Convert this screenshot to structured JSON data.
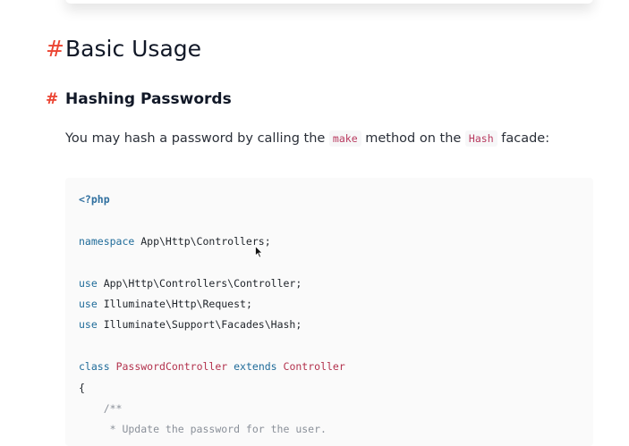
{
  "section_heading": {
    "hash": "#",
    "text": "Basic Usage"
  },
  "subsection_heading": {
    "hash": "#",
    "text": "Hashing Passwords"
  },
  "intro_paragraph": {
    "text_before": "You may hash a password by calling the ",
    "code_1": "make",
    "text_middle": " method on the ",
    "code_2": "Hash",
    "text_after": " facade:"
  },
  "code_block": {
    "language": "php",
    "lines": [
      [
        {
          "t": "<?php",
          "c": "php"
        }
      ],
      [],
      [
        {
          "t": "namespace",
          "c": "kw"
        },
        {
          "t": " App\\Http\\Controllers;",
          "c": ""
        }
      ],
      [],
      [
        {
          "t": "use",
          "c": "kw"
        },
        {
          "t": " App\\Http\\Controllers\\Controller;",
          "c": ""
        }
      ],
      [
        {
          "t": "use",
          "c": "kw"
        },
        {
          "t": " Illuminate\\Http\\Request;",
          "c": ""
        }
      ],
      [
        {
          "t": "use",
          "c": "kw"
        },
        {
          "t": " Illuminate\\Support\\Facades\\Hash;",
          "c": ""
        }
      ],
      [],
      [
        {
          "t": "class",
          "c": "kw"
        },
        {
          "t": " ",
          "c": ""
        },
        {
          "t": "PasswordController",
          "c": "cls"
        },
        {
          "t": " ",
          "c": ""
        },
        {
          "t": "extends",
          "c": "kw"
        },
        {
          "t": " ",
          "c": ""
        },
        {
          "t": "Controller",
          "c": "cls"
        }
      ],
      [
        {
          "t": "{",
          "c": ""
        }
      ],
      [
        {
          "t": "    /**",
          "c": "cmt"
        }
      ],
      [
        {
          "t": "     * Update the password for the user.",
          "c": "cmt"
        }
      ]
    ]
  }
}
